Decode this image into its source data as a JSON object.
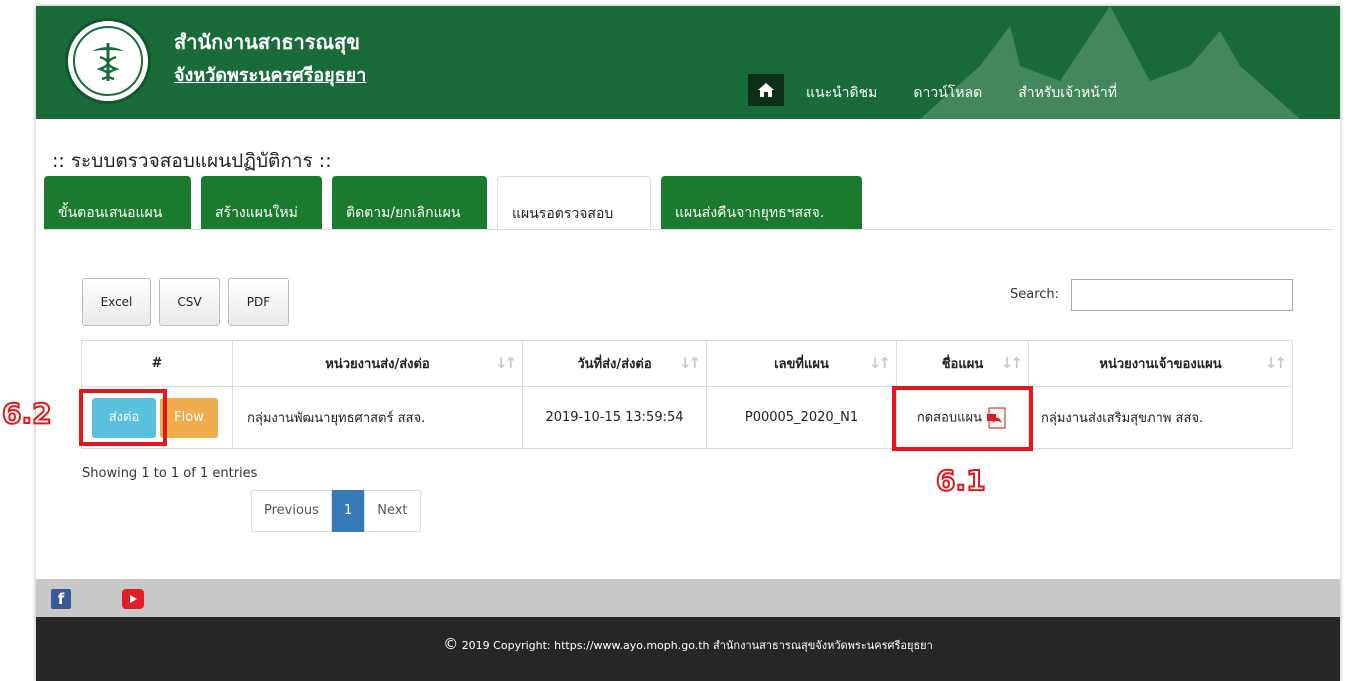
{
  "header": {
    "org_title": "สำนักงานสาธารณสุข",
    "org_subtitle": "จังหวัดพระนครศรีอยุธยา",
    "nav": [
      "แนะนำดิชม",
      "ดาวน์โหลด",
      "สำหรับเจ้าหน้าที่"
    ]
  },
  "page_title": ":: ระบบตรวจสอบแผนปฏิบัติการ ::",
  "tabs": [
    {
      "label": "ขั้นตอนเสนอแผน",
      "active": false
    },
    {
      "label": "สร้างแผนใหม่",
      "active": false
    },
    {
      "label": "ติดตาม/ยกเลิกแผน",
      "active": false
    },
    {
      "label": "แผนรอตรวจสอบ",
      "active": true
    },
    {
      "label": "แผนส่งคืนจากยุทธฯสสจ.",
      "active": false
    }
  ],
  "toolbar": {
    "excel": "Excel",
    "csv": "CSV",
    "pdf": "PDF",
    "search_label": "Search:",
    "search_value": ""
  },
  "table": {
    "headers": [
      "#",
      "หน่วยงานส่ง/ส่งต่อ",
      "วันที่ส่ง/ส่งต่อ",
      "เลขที่แผน",
      "ชื่อแผน",
      "หน่วยงานเจ้าของแผน"
    ],
    "rows": [
      {
        "send_label": "ส่งต่อ",
        "flow_label": "Flow",
        "sender": "กลุ่มงานพัฒนายุทธศาสตร์ สสจ.",
        "date": "2019-10-15 13:59:54",
        "plan_no": "P00005_2020_N1",
        "plan_name": "กดสอบแผน",
        "owner": "กลุ่มงานส่งเสริมสุขภาพ สสจ."
      }
    ]
  },
  "info_text": "Showing 1 to 1 of 1 entries",
  "pagination": {
    "prev": "Previous",
    "current": "1",
    "next": "Next"
  },
  "annotations": {
    "a1": "6.1",
    "a2": "6.2"
  },
  "footer": {
    "copyright": "2019 Copyright: https://www.ayo.moph.go.th สำนักงานสาธารณสุขจังหวัดพระนครศรีอยุธยา"
  },
  "colors": {
    "header_green": "#1a6b3a",
    "tab_green": "#1a7a2e",
    "send_blue": "#5bc0de",
    "flow_orange": "#f0ad4e",
    "annotation_red": "#e5161b"
  }
}
